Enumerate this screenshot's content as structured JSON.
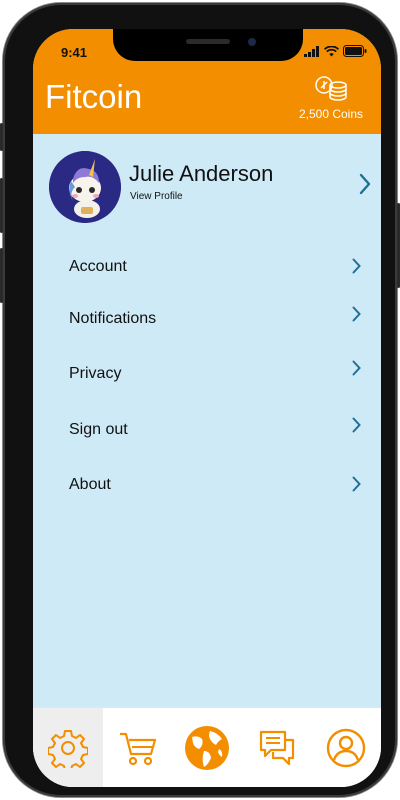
{
  "status_bar": {
    "time": "9:41"
  },
  "header": {
    "title": "Fitcoin",
    "coins_label": "2,500 Coins",
    "coins_icon": "coins-icon"
  },
  "profile": {
    "name": "Julie Anderson",
    "link": "View Profile",
    "avatar": "unicorn-avatar"
  },
  "menu": {
    "items": [
      {
        "label": "Account"
      },
      {
        "label": "Notifications"
      },
      {
        "label": "Privacy"
      },
      {
        "label": "Sign out"
      },
      {
        "label": "About"
      }
    ]
  },
  "tabbar": {
    "tabs": [
      {
        "icon": "gear-icon",
        "active": true
      },
      {
        "icon": "cart-icon",
        "active": false
      },
      {
        "icon": "globe-icon",
        "active": false
      },
      {
        "icon": "chat-icon",
        "active": false
      },
      {
        "icon": "profile-icon",
        "active": false
      }
    ]
  },
  "colors": {
    "accent": "#f28e00",
    "background": "#cfeaf7",
    "chevron": "#1f6f97"
  }
}
